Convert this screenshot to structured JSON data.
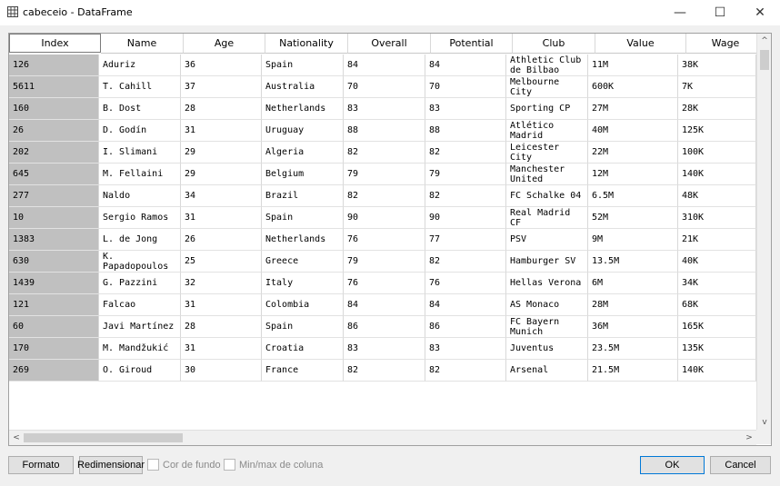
{
  "window": {
    "title": "cabeceio - DataFrame",
    "icon": "table-icon",
    "minimize_glyph": "—",
    "maximize_glyph": "☐",
    "close_glyph": "✕"
  },
  "table": {
    "columns": [
      "Index",
      "Name",
      "Age",
      "Nationality",
      "Overall",
      "Potential",
      "Club",
      "Value",
      "Wage"
    ],
    "rows": [
      [
        "126",
        "Aduriz",
        "36",
        "Spain",
        "84",
        "84",
        "Athletic Club\nde Bilbao",
        "11M",
        "38K"
      ],
      [
        "5611",
        "T. Cahill",
        "37",
        "Australia",
        "70",
        "70",
        "Melbourne\nCity",
        "600K",
        "7K"
      ],
      [
        "160",
        "B. Dost",
        "28",
        "Netherlands",
        "83",
        "83",
        "Sporting CP",
        "27M",
        "28K"
      ],
      [
        "26",
        "D. Godín",
        "31",
        "Uruguay",
        "88",
        "88",
        "Atlético\nMadrid",
        "40M",
        "125K"
      ],
      [
        "202",
        "I. Slimani",
        "29",
        "Algeria",
        "82",
        "82",
        "Leicester\nCity",
        "22M",
        "100K"
      ],
      [
        "645",
        "M. Fellaini",
        "29",
        "Belgium",
        "79",
        "79",
        "Manchester\nUnited",
        "12M",
        "140K"
      ],
      [
        "277",
        "Naldo",
        "34",
        "Brazil",
        "82",
        "82",
        "FC Schalke 04",
        "6.5M",
        "48K"
      ],
      [
        "10",
        "Sergio Ramos",
        "31",
        "Spain",
        "90",
        "90",
        "Real Madrid\nCF",
        "52M",
        "310K"
      ],
      [
        "1383",
        "L. de Jong",
        "26",
        "Netherlands",
        "76",
        "77",
        "PSV",
        "9M",
        "21K"
      ],
      [
        "630",
        "K.\nPapadopoulos",
        "25",
        "Greece",
        "79",
        "82",
        "Hamburger SV",
        "13.5M",
        "40K"
      ],
      [
        "1439",
        "G. Pazzini",
        "32",
        "Italy",
        "76",
        "76",
        "Hellas Verona",
        "6M",
        "34K"
      ],
      [
        "121",
        "Falcao",
        "31",
        "Colombia",
        "84",
        "84",
        "AS Monaco",
        "28M",
        "68K"
      ],
      [
        "60",
        "Javi Martínez",
        "28",
        "Spain",
        "86",
        "86",
        "FC Bayern\nMunich",
        "36M",
        "165K"
      ],
      [
        "170",
        "M. Mandžukić",
        "31",
        "Croatia",
        "83",
        "83",
        "Juventus",
        "23.5M",
        "135K"
      ],
      [
        "269",
        "O. Giroud",
        "30",
        "France",
        "82",
        "82",
        "Arsenal",
        "21.5M",
        "140K"
      ]
    ]
  },
  "scroll": {
    "up_arrow": "^",
    "down_arrow": "v",
    "left_arrow": "<",
    "right_arrow": ">"
  },
  "footer": {
    "format_label": "Formato",
    "resize_label": "Redimensionar",
    "background_color_label": "Cor de fundo",
    "minmax_label": "Min/max de coluna",
    "ok_label": "OK",
    "cancel_label": "Cancel"
  }
}
